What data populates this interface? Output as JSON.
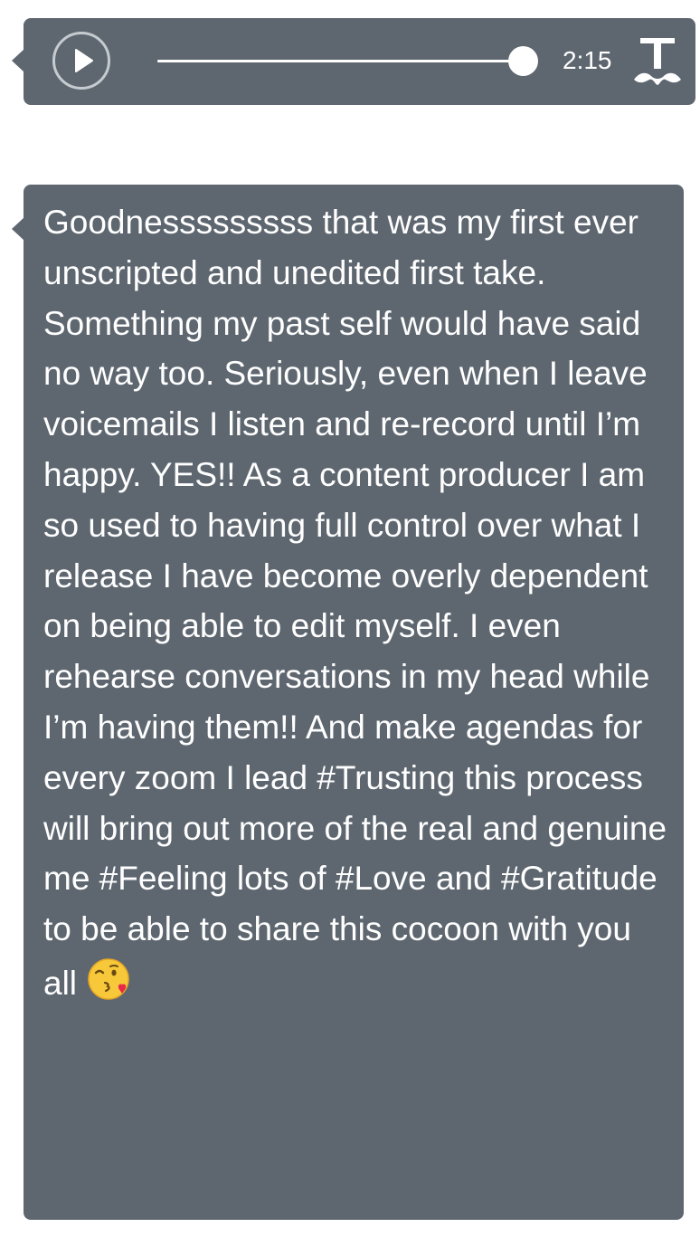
{
  "audio_player": {
    "duration": "2:15",
    "progress": 1.0,
    "play_icon": "play-icon",
    "brand_icon": "tumblr-t-icon"
  },
  "post": {
    "text": "Goodnesssssssss that was my first ever unscripted and unedited first take. Something my past self would have said no way too. Seriously, even when I leave voicemails I listen and re-record until I’m happy. YES!! As a content producer I am so used to having full control over what I release I have become overly dependent on being able to edit myself. I even rehearse conversations in my head while I’m having them!! And make agendas for every zoom I lead #Trusting this process will bring out more of the real and genuine me #Feeling lots of #Love and #Gratitude to be able to share this cocoon with you all ",
    "emoji": "face-blowing-a-kiss-emoji"
  },
  "colors": {
    "bubble": "#5e6770",
    "text": "#ffffff",
    "play_ring": "#c6cbd0"
  }
}
